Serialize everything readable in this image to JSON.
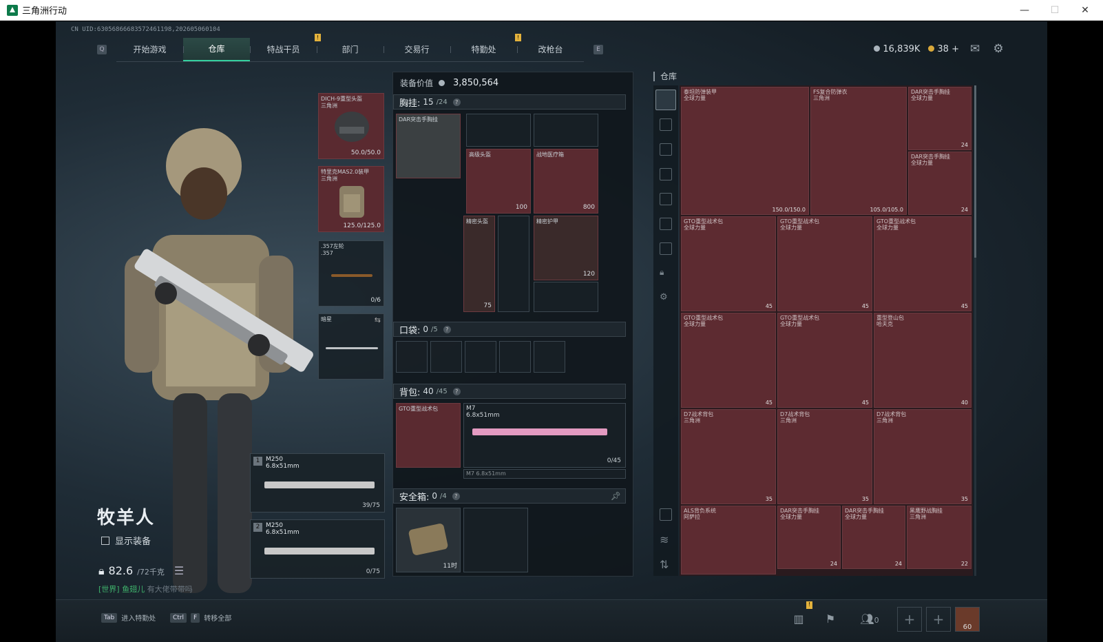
{
  "window": {
    "title": "三角洲行动",
    "controls": [
      "—",
      "☐",
      "✕"
    ]
  },
  "header": {
    "uid": "CN UID:6305686668357246119​8,202605060104",
    "tab_key_left": "Q",
    "tab_key_right": "E",
    "tabs": [
      {
        "label": "开始游戏",
        "active": false,
        "badge": ""
      },
      {
        "label": "仓库",
        "active": true,
        "badge": ""
      },
      {
        "label": "特战干员",
        "active": false,
        "badge": "!"
      },
      {
        "label": "部门",
        "active": false,
        "badge": ""
      },
      {
        "label": "交易行",
        "active": false,
        "badge": ""
      },
      {
        "label": "特勤处",
        "active": false,
        "badge": "!"
      },
      {
        "label": "改枪台",
        "active": false,
        "badge": ""
      }
    ],
    "currency": {
      "silver": "16,839K",
      "gold": "38",
      "plus": "+"
    },
    "icons": [
      "mail-icon",
      "gear-icon"
    ]
  },
  "character": {
    "name": "牧羊人",
    "show_gear_label": "显示装备",
    "weight": "82.6",
    "weight_max": "/72千克",
    "chat_channel": "[世界]",
    "chat_user": "鱼翅儿",
    "chat_text": "有大佬带带吗"
  },
  "equip_slots": {
    "helmet": {
      "name": "DICH-9重型头盔",
      "sub": "三角洲",
      "durability": "50.0/50.0"
    },
    "armor": {
      "name": "特里克MAS2.0装甲",
      "sub": "三角洲",
      "durability": "125.0/125.0"
    },
    "pistol": {
      "name": ".357左轮",
      "sub": ".357",
      "ammo": "0/6"
    },
    "melee": {
      "name": "暗星",
      "sub": ""
    },
    "primary1": {
      "slot": "1",
      "name": "M250",
      "caliber": "6.8x51mm",
      "ammo": "39/75"
    },
    "primary2": {
      "slot": "2",
      "name": "M250",
      "caliber": "6.8x51mm",
      "ammo": "0/75"
    }
  },
  "gear": {
    "value_label": "装备价值",
    "value": "3,850,564",
    "chest": {
      "label": "胸挂:",
      "used": "15",
      "cap": "/24",
      "item": "DAR突击手胸挂"
    },
    "chest_items": [
      {
        "name": "高级头盔",
        "val": "100"
      },
      {
        "name": "战地医疗箱",
        "val": "800"
      },
      {
        "name": "精密头盔",
        "val": "75"
      },
      {
        "name": "精密护甲",
        "val": "120"
      }
    ],
    "pocket": {
      "label": "口袋:",
      "used": "0",
      "cap": "/5"
    },
    "backpack": {
      "label": "背包:",
      "used": "40",
      "cap": "/45",
      "item": "GTO重型战术包"
    },
    "backpack_items": [
      {
        "name": "M7",
        "caliber": "6.8x51mm",
        "ammo": "0/45"
      },
      {
        "name": "M7",
        "caliber": "6.8x51mm"
      }
    ],
    "safebox": {
      "label": "安全箱:",
      "used": "0",
      "cap": "/4",
      "time": "11时"
    }
  },
  "stash": {
    "title": "仓库",
    "items": [
      {
        "name": "泰坦防弹装甲",
        "sub": "全球力量",
        "val": "150.0/150.0"
      },
      {
        "name": "FS复合防弹衣",
        "sub": "三角洲",
        "val": "105.0/105.0"
      },
      {
        "name": "DAR突击手胸挂",
        "sub": "全球力量",
        "val": "24"
      },
      {
        "name": "DAR突击手胸挂",
        "sub": "全球力量",
        "val": "24"
      },
      {
        "name": "GTO重型战术包",
        "sub": "全球力量",
        "val": "45"
      },
      {
        "name": "GTO重型战术包",
        "sub": "全球力量",
        "val": "45"
      },
      {
        "name": "GTO重型战术包",
        "sub": "全球力量",
        "val": "45"
      },
      {
        "name": "GTO重型战术包",
        "sub": "全球力量",
        "val": "45"
      },
      {
        "name": "GTO重型战术包",
        "sub": "全球力量",
        "val": "45"
      },
      {
        "name": "重型登山包",
        "sub": "哈夫克",
        "val": "40"
      },
      {
        "name": "D7战术背包",
        "sub": "三角洲",
        "val": "35"
      },
      {
        "name": "D7战术背包",
        "sub": "三角洲",
        "val": "35"
      },
      {
        "name": "D7战术背包",
        "sub": "三角洲",
        "val": "35"
      },
      {
        "name": "ALS背负系统",
        "sub": "阿萨拉",
        "val": ""
      },
      {
        "name": "DAR突击手胸挂",
        "sub": "全球力量",
        "val": "24"
      },
      {
        "name": "DAR突击手胸挂",
        "sub": "全球力量",
        "val": "24"
      },
      {
        "name": "黑鹰野战胸挂",
        "sub": "三角洲",
        "val": "22"
      }
    ]
  },
  "bottom": {
    "hint1_key": "Tab",
    "hint1_label": "进入特勤处",
    "hint2_key1": "Ctrl",
    "hint2_key2": "F",
    "hint2_label": "转移全部",
    "squad_count": "0",
    "badge": "!",
    "avatar_label": "60"
  }
}
